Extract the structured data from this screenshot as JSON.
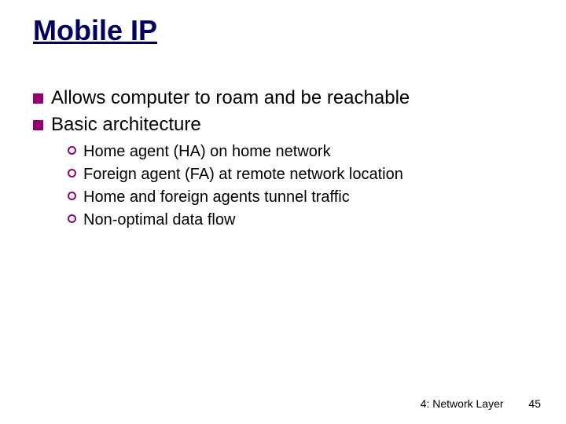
{
  "title": "Mobile IP",
  "bullets": [
    {
      "text": "Allows computer to roam and be reachable"
    },
    {
      "text": "Basic architecture"
    }
  ],
  "sub_bullets": [
    {
      "text": "Home agent (HA) on home network"
    },
    {
      "text": "Foreign agent (FA) at remote network location"
    },
    {
      "text": "Home and foreign agents tunnel traffic"
    },
    {
      "text": "Non-optimal data flow"
    }
  ],
  "footer": {
    "section": "4: Network Layer",
    "page": "45"
  }
}
